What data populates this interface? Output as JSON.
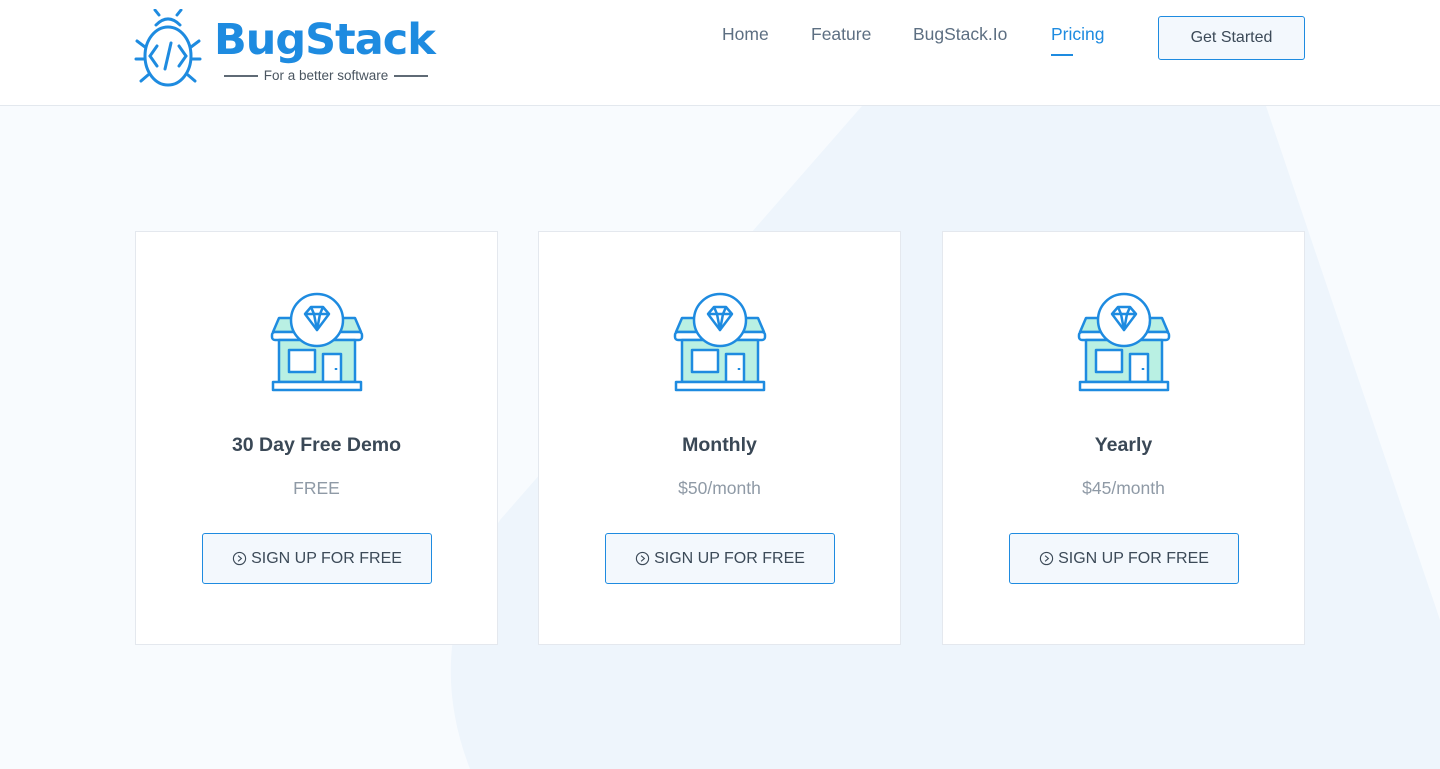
{
  "brand": {
    "name": "BugStack",
    "tagline": "For a better software",
    "color": "#1e8be0"
  },
  "nav": {
    "items": [
      {
        "label": "Home",
        "active": false
      },
      {
        "label": "Feature",
        "active": false
      },
      {
        "label": "BugStack.Io",
        "active": false
      },
      {
        "label": "Pricing",
        "active": true
      }
    ],
    "cta_label": "Get Started"
  },
  "plans": [
    {
      "title": "30 Day Free Demo",
      "price": "FREE",
      "button_label": "SIGN UP FOR FREE",
      "icon": "store-diamond-icon"
    },
    {
      "title": "Monthly",
      "price": "$50/month",
      "button_label": "SIGN UP FOR FREE",
      "icon": "store-diamond-icon"
    },
    {
      "title": "Yearly",
      "price": "$45/month",
      "button_label": "SIGN UP FOR FREE",
      "icon": "store-diamond-icon"
    }
  ],
  "colors": {
    "accent": "#1e8be0",
    "icon_fill": "#b9f0e3",
    "background": "#f8fbfe",
    "background_shape": "#eef5fc"
  }
}
